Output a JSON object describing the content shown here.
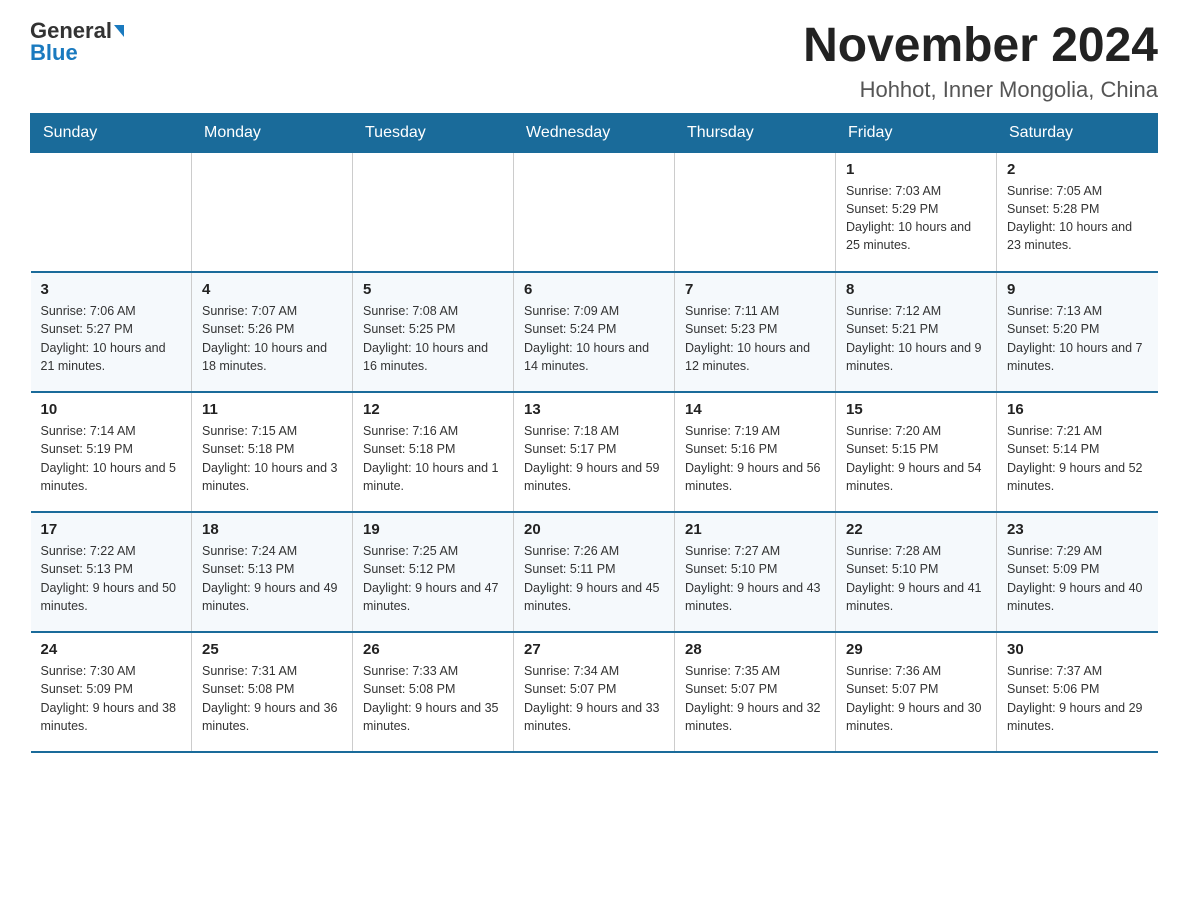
{
  "header": {
    "logo_general": "General",
    "logo_blue": "Blue",
    "title": "November 2024",
    "subtitle": "Hohhot, Inner Mongolia, China"
  },
  "days_of_week": [
    "Sunday",
    "Monday",
    "Tuesday",
    "Wednesday",
    "Thursday",
    "Friday",
    "Saturday"
  ],
  "weeks": [
    [
      {
        "day": "",
        "info": ""
      },
      {
        "day": "",
        "info": ""
      },
      {
        "day": "",
        "info": ""
      },
      {
        "day": "",
        "info": ""
      },
      {
        "day": "",
        "info": ""
      },
      {
        "day": "1",
        "info": "Sunrise: 7:03 AM\nSunset: 5:29 PM\nDaylight: 10 hours and 25 minutes."
      },
      {
        "day": "2",
        "info": "Sunrise: 7:05 AM\nSunset: 5:28 PM\nDaylight: 10 hours and 23 minutes."
      }
    ],
    [
      {
        "day": "3",
        "info": "Sunrise: 7:06 AM\nSunset: 5:27 PM\nDaylight: 10 hours and 21 minutes."
      },
      {
        "day": "4",
        "info": "Sunrise: 7:07 AM\nSunset: 5:26 PM\nDaylight: 10 hours and 18 minutes."
      },
      {
        "day": "5",
        "info": "Sunrise: 7:08 AM\nSunset: 5:25 PM\nDaylight: 10 hours and 16 minutes."
      },
      {
        "day": "6",
        "info": "Sunrise: 7:09 AM\nSunset: 5:24 PM\nDaylight: 10 hours and 14 minutes."
      },
      {
        "day": "7",
        "info": "Sunrise: 7:11 AM\nSunset: 5:23 PM\nDaylight: 10 hours and 12 minutes."
      },
      {
        "day": "8",
        "info": "Sunrise: 7:12 AM\nSunset: 5:21 PM\nDaylight: 10 hours and 9 minutes."
      },
      {
        "day": "9",
        "info": "Sunrise: 7:13 AM\nSunset: 5:20 PM\nDaylight: 10 hours and 7 minutes."
      }
    ],
    [
      {
        "day": "10",
        "info": "Sunrise: 7:14 AM\nSunset: 5:19 PM\nDaylight: 10 hours and 5 minutes."
      },
      {
        "day": "11",
        "info": "Sunrise: 7:15 AM\nSunset: 5:18 PM\nDaylight: 10 hours and 3 minutes."
      },
      {
        "day": "12",
        "info": "Sunrise: 7:16 AM\nSunset: 5:18 PM\nDaylight: 10 hours and 1 minute."
      },
      {
        "day": "13",
        "info": "Sunrise: 7:18 AM\nSunset: 5:17 PM\nDaylight: 9 hours and 59 minutes."
      },
      {
        "day": "14",
        "info": "Sunrise: 7:19 AM\nSunset: 5:16 PM\nDaylight: 9 hours and 56 minutes."
      },
      {
        "day": "15",
        "info": "Sunrise: 7:20 AM\nSunset: 5:15 PM\nDaylight: 9 hours and 54 minutes."
      },
      {
        "day": "16",
        "info": "Sunrise: 7:21 AM\nSunset: 5:14 PM\nDaylight: 9 hours and 52 minutes."
      }
    ],
    [
      {
        "day": "17",
        "info": "Sunrise: 7:22 AM\nSunset: 5:13 PM\nDaylight: 9 hours and 50 minutes."
      },
      {
        "day": "18",
        "info": "Sunrise: 7:24 AM\nSunset: 5:13 PM\nDaylight: 9 hours and 49 minutes."
      },
      {
        "day": "19",
        "info": "Sunrise: 7:25 AM\nSunset: 5:12 PM\nDaylight: 9 hours and 47 minutes."
      },
      {
        "day": "20",
        "info": "Sunrise: 7:26 AM\nSunset: 5:11 PM\nDaylight: 9 hours and 45 minutes."
      },
      {
        "day": "21",
        "info": "Sunrise: 7:27 AM\nSunset: 5:10 PM\nDaylight: 9 hours and 43 minutes."
      },
      {
        "day": "22",
        "info": "Sunrise: 7:28 AM\nSunset: 5:10 PM\nDaylight: 9 hours and 41 minutes."
      },
      {
        "day": "23",
        "info": "Sunrise: 7:29 AM\nSunset: 5:09 PM\nDaylight: 9 hours and 40 minutes."
      }
    ],
    [
      {
        "day": "24",
        "info": "Sunrise: 7:30 AM\nSunset: 5:09 PM\nDaylight: 9 hours and 38 minutes."
      },
      {
        "day": "25",
        "info": "Sunrise: 7:31 AM\nSunset: 5:08 PM\nDaylight: 9 hours and 36 minutes."
      },
      {
        "day": "26",
        "info": "Sunrise: 7:33 AM\nSunset: 5:08 PM\nDaylight: 9 hours and 35 minutes."
      },
      {
        "day": "27",
        "info": "Sunrise: 7:34 AM\nSunset: 5:07 PM\nDaylight: 9 hours and 33 minutes."
      },
      {
        "day": "28",
        "info": "Sunrise: 7:35 AM\nSunset: 5:07 PM\nDaylight: 9 hours and 32 minutes."
      },
      {
        "day": "29",
        "info": "Sunrise: 7:36 AM\nSunset: 5:07 PM\nDaylight: 9 hours and 30 minutes."
      },
      {
        "day": "30",
        "info": "Sunrise: 7:37 AM\nSunset: 5:06 PM\nDaylight: 9 hours and 29 minutes."
      }
    ]
  ]
}
